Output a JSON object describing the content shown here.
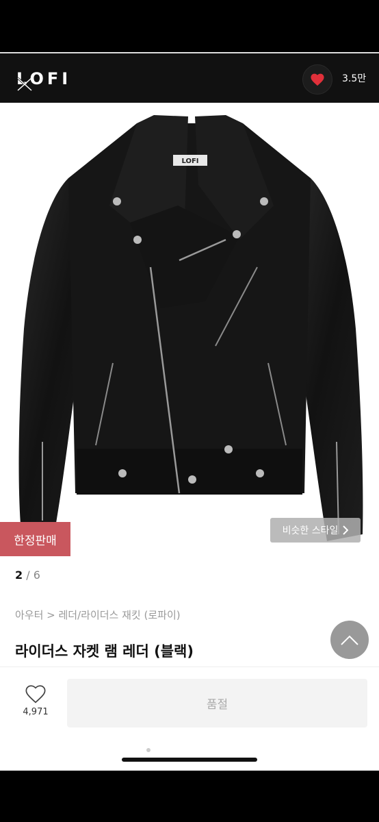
{
  "header": {
    "logo": "LOFI",
    "like_count": "3.5만"
  },
  "product": {
    "badge": "한정판매",
    "similar_style": "비슷한 스타일",
    "image_label": "LOFI",
    "pager_current": "2",
    "pager_separator": " / ",
    "pager_total": "6",
    "breadcrumb": "아우터 > 레더/라이더스 재킷 (로파이)",
    "title": "라이더스 자켓 램 레더 (블랙)"
  },
  "bottom_bar": {
    "like_count": "4,971",
    "soldout_label": "품절"
  },
  "colors": {
    "badge": "#c9575e",
    "heart": "#e0303a",
    "header_bg": "#111111"
  }
}
